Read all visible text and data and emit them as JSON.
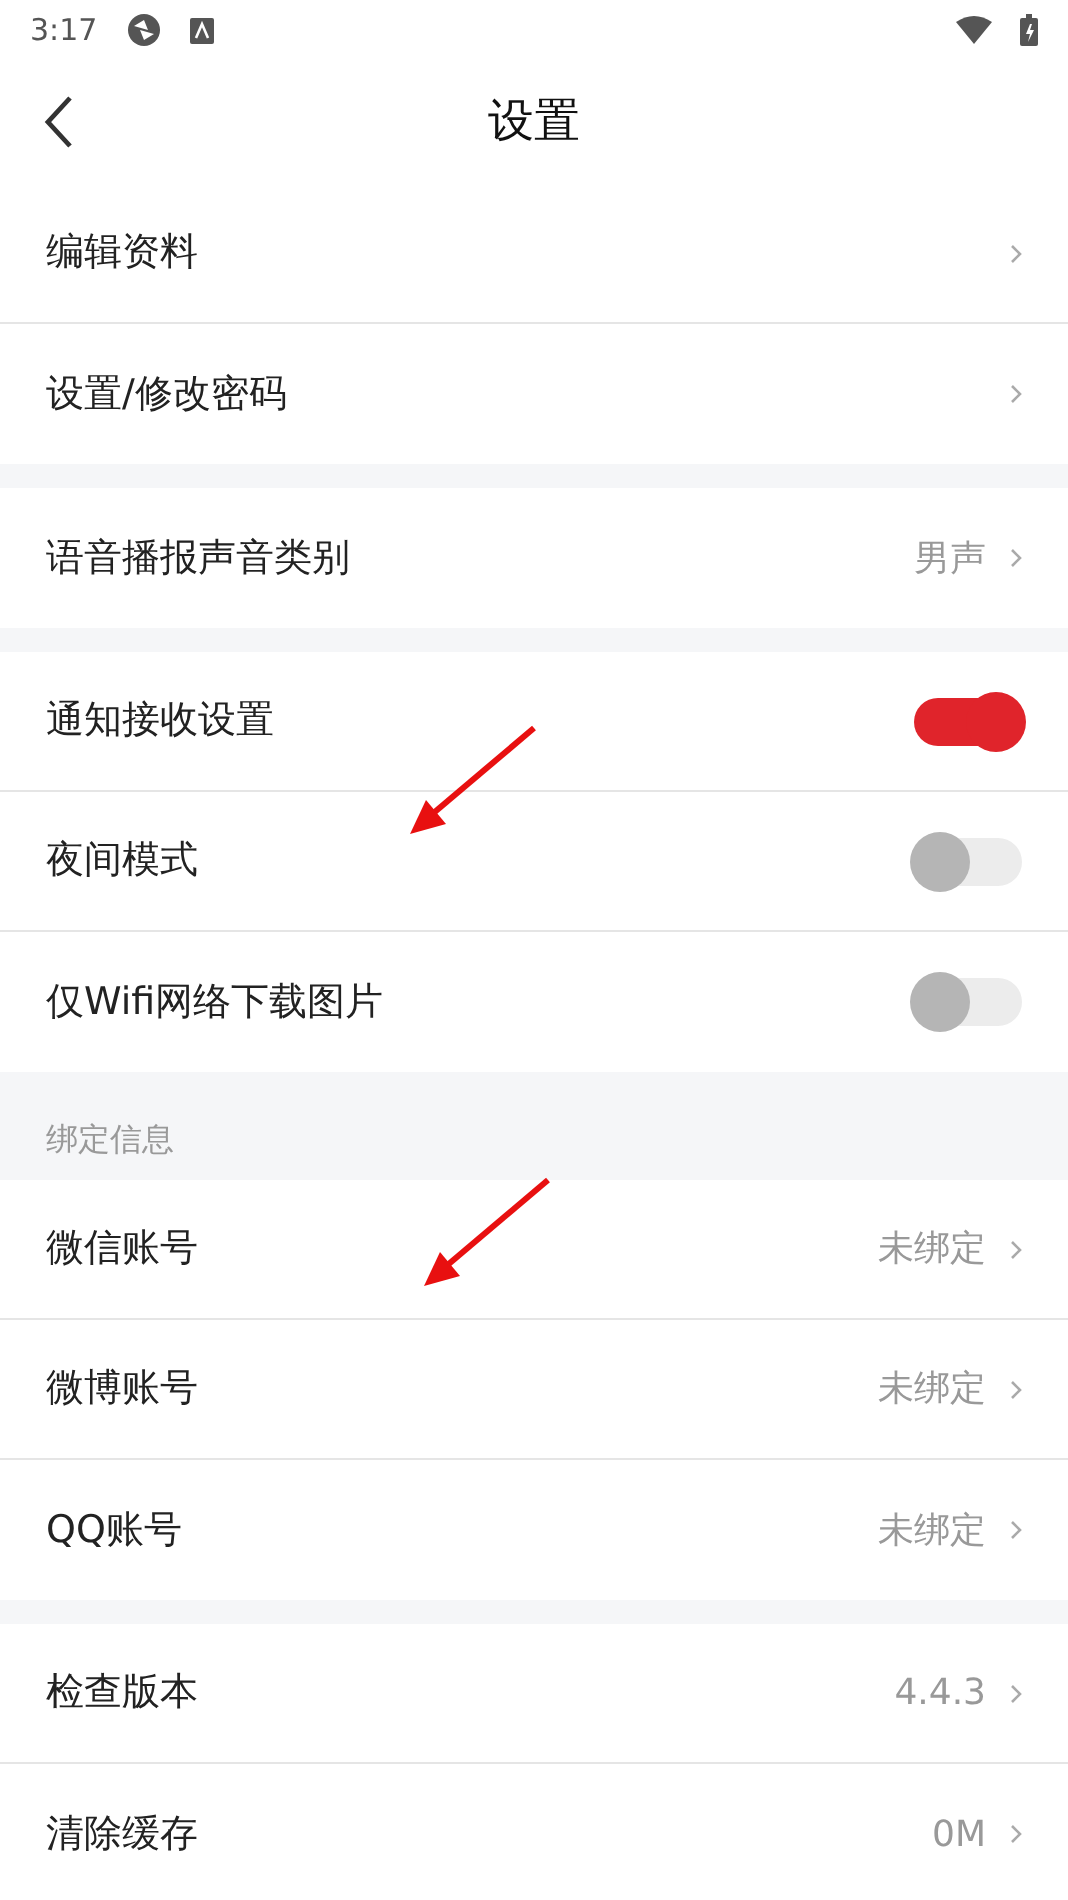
{
  "status_bar": {
    "time": "3:17"
  },
  "header": {
    "title": "设置"
  },
  "sections": [
    {
      "items": [
        {
          "kind": "link",
          "label": "编辑资料"
        },
        {
          "kind": "link",
          "label": "设置/修改密码"
        }
      ]
    },
    {
      "items": [
        {
          "kind": "link",
          "label": "语音播报声音类别",
          "value": "男声"
        }
      ]
    },
    {
      "items": [
        {
          "kind": "toggle",
          "label": "通知接收设置",
          "on": true
        },
        {
          "kind": "toggle",
          "label": "夜间模式",
          "on": false
        },
        {
          "kind": "toggle",
          "label": "仅Wifi网络下载图片",
          "on": false
        }
      ]
    },
    {
      "title": "绑定信息",
      "items": [
        {
          "kind": "link",
          "label": "微信账号",
          "value": "未绑定"
        },
        {
          "kind": "link",
          "label": "微博账号",
          "value": "未绑定"
        },
        {
          "kind": "link",
          "label": "QQ账号",
          "value": "未绑定"
        }
      ]
    },
    {
      "items": [
        {
          "kind": "link",
          "label": "检查版本",
          "value": "4.4.3"
        },
        {
          "kind": "link",
          "label": "清除缓存",
          "value": "0M"
        }
      ]
    }
  ]
}
